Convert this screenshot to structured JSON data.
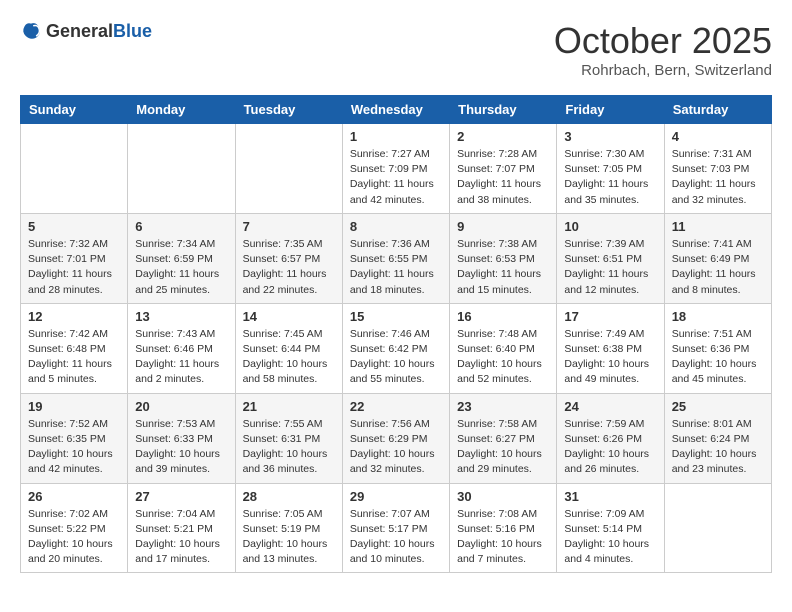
{
  "header": {
    "logo_general": "General",
    "logo_blue": "Blue",
    "title": "October 2025",
    "subtitle": "Rohrbach, Bern, Switzerland"
  },
  "weekdays": [
    "Sunday",
    "Monday",
    "Tuesday",
    "Wednesday",
    "Thursday",
    "Friday",
    "Saturday"
  ],
  "weeks": [
    [
      {
        "num": "",
        "info": ""
      },
      {
        "num": "",
        "info": ""
      },
      {
        "num": "",
        "info": ""
      },
      {
        "num": "1",
        "info": "Sunrise: 7:27 AM\nSunset: 7:09 PM\nDaylight: 11 hours\nand 42 minutes."
      },
      {
        "num": "2",
        "info": "Sunrise: 7:28 AM\nSunset: 7:07 PM\nDaylight: 11 hours\nand 38 minutes."
      },
      {
        "num": "3",
        "info": "Sunrise: 7:30 AM\nSunset: 7:05 PM\nDaylight: 11 hours\nand 35 minutes."
      },
      {
        "num": "4",
        "info": "Sunrise: 7:31 AM\nSunset: 7:03 PM\nDaylight: 11 hours\nand 32 minutes."
      }
    ],
    [
      {
        "num": "5",
        "info": "Sunrise: 7:32 AM\nSunset: 7:01 PM\nDaylight: 11 hours\nand 28 minutes."
      },
      {
        "num": "6",
        "info": "Sunrise: 7:34 AM\nSunset: 6:59 PM\nDaylight: 11 hours\nand 25 minutes."
      },
      {
        "num": "7",
        "info": "Sunrise: 7:35 AM\nSunset: 6:57 PM\nDaylight: 11 hours\nand 22 minutes."
      },
      {
        "num": "8",
        "info": "Sunrise: 7:36 AM\nSunset: 6:55 PM\nDaylight: 11 hours\nand 18 minutes."
      },
      {
        "num": "9",
        "info": "Sunrise: 7:38 AM\nSunset: 6:53 PM\nDaylight: 11 hours\nand 15 minutes."
      },
      {
        "num": "10",
        "info": "Sunrise: 7:39 AM\nSunset: 6:51 PM\nDaylight: 11 hours\nand 12 minutes."
      },
      {
        "num": "11",
        "info": "Sunrise: 7:41 AM\nSunset: 6:49 PM\nDaylight: 11 hours\nand 8 minutes."
      }
    ],
    [
      {
        "num": "12",
        "info": "Sunrise: 7:42 AM\nSunset: 6:48 PM\nDaylight: 11 hours\nand 5 minutes."
      },
      {
        "num": "13",
        "info": "Sunrise: 7:43 AM\nSunset: 6:46 PM\nDaylight: 11 hours\nand 2 minutes."
      },
      {
        "num": "14",
        "info": "Sunrise: 7:45 AM\nSunset: 6:44 PM\nDaylight: 10 hours\nand 58 minutes."
      },
      {
        "num": "15",
        "info": "Sunrise: 7:46 AM\nSunset: 6:42 PM\nDaylight: 10 hours\nand 55 minutes."
      },
      {
        "num": "16",
        "info": "Sunrise: 7:48 AM\nSunset: 6:40 PM\nDaylight: 10 hours\nand 52 minutes."
      },
      {
        "num": "17",
        "info": "Sunrise: 7:49 AM\nSunset: 6:38 PM\nDaylight: 10 hours\nand 49 minutes."
      },
      {
        "num": "18",
        "info": "Sunrise: 7:51 AM\nSunset: 6:36 PM\nDaylight: 10 hours\nand 45 minutes."
      }
    ],
    [
      {
        "num": "19",
        "info": "Sunrise: 7:52 AM\nSunset: 6:35 PM\nDaylight: 10 hours\nand 42 minutes."
      },
      {
        "num": "20",
        "info": "Sunrise: 7:53 AM\nSunset: 6:33 PM\nDaylight: 10 hours\nand 39 minutes."
      },
      {
        "num": "21",
        "info": "Sunrise: 7:55 AM\nSunset: 6:31 PM\nDaylight: 10 hours\nand 36 minutes."
      },
      {
        "num": "22",
        "info": "Sunrise: 7:56 AM\nSunset: 6:29 PM\nDaylight: 10 hours\nand 32 minutes."
      },
      {
        "num": "23",
        "info": "Sunrise: 7:58 AM\nSunset: 6:27 PM\nDaylight: 10 hours\nand 29 minutes."
      },
      {
        "num": "24",
        "info": "Sunrise: 7:59 AM\nSunset: 6:26 PM\nDaylight: 10 hours\nand 26 minutes."
      },
      {
        "num": "25",
        "info": "Sunrise: 8:01 AM\nSunset: 6:24 PM\nDaylight: 10 hours\nand 23 minutes."
      }
    ],
    [
      {
        "num": "26",
        "info": "Sunrise: 7:02 AM\nSunset: 5:22 PM\nDaylight: 10 hours\nand 20 minutes."
      },
      {
        "num": "27",
        "info": "Sunrise: 7:04 AM\nSunset: 5:21 PM\nDaylight: 10 hours\nand 17 minutes."
      },
      {
        "num": "28",
        "info": "Sunrise: 7:05 AM\nSunset: 5:19 PM\nDaylight: 10 hours\nand 13 minutes."
      },
      {
        "num": "29",
        "info": "Sunrise: 7:07 AM\nSunset: 5:17 PM\nDaylight: 10 hours\nand 10 minutes."
      },
      {
        "num": "30",
        "info": "Sunrise: 7:08 AM\nSunset: 5:16 PM\nDaylight: 10 hours\nand 7 minutes."
      },
      {
        "num": "31",
        "info": "Sunrise: 7:09 AM\nSunset: 5:14 PM\nDaylight: 10 hours\nand 4 minutes."
      },
      {
        "num": "",
        "info": ""
      }
    ]
  ]
}
